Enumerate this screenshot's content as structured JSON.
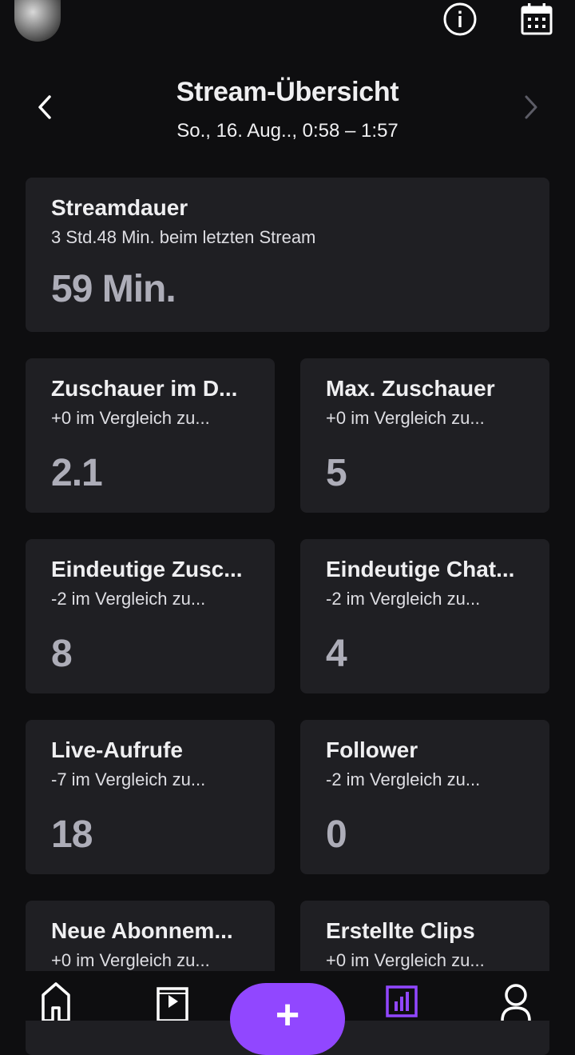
{
  "header": {
    "icons": [
      "avatar",
      "info-icon",
      "calendar-icon"
    ]
  },
  "overview": {
    "title": "Stream-Übersicht",
    "subtitle": "So., 16. Aug.., 0:58 – 1:57"
  },
  "duration_card": {
    "title": "Streamdauer",
    "subtitle": "3 Std.48 Min. beim letzten Stream",
    "value": "59 Min."
  },
  "stats": [
    {
      "title": "Zuschauer im D...",
      "subtitle": "+0 im Vergleich zu...",
      "value": "2.1"
    },
    {
      "title": "Max. Zuschauer",
      "subtitle": "+0 im Vergleich zu...",
      "value": "5"
    },
    {
      "title": "Eindeutige Zusc...",
      "subtitle": "-2 im Vergleich zu...",
      "value": "8"
    },
    {
      "title": "Eindeutige Chat...",
      "subtitle": "-2 im Vergleich zu...",
      "value": "4"
    },
    {
      "title": "Live-Aufrufe",
      "subtitle": "-7 im Vergleich zu...",
      "value": "18"
    },
    {
      "title": "Follower",
      "subtitle": "-2 im Vergleich zu...",
      "value": "0"
    },
    {
      "title": "Neue Abonnem...",
      "subtitle": "+0 im Vergleich zu...",
      "value": ""
    },
    {
      "title": "Erstellte Clips",
      "subtitle": "+0 im Vergleich zu...",
      "value": ""
    }
  ],
  "bottom_nav": {
    "fab_label": "+",
    "active_color": "#9147ff",
    "items": [
      "home-icon",
      "video-icon",
      "create-button",
      "stats-icon",
      "profile-icon"
    ]
  }
}
